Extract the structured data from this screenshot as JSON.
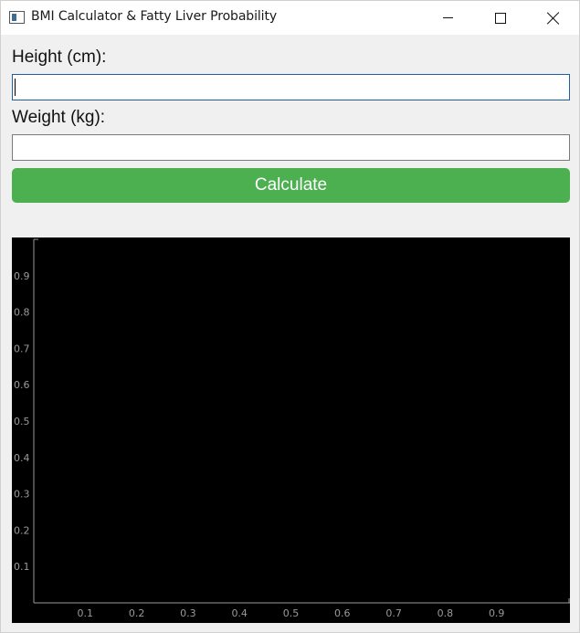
{
  "window": {
    "title": "BMI Calculator & Fatty Liver Probability",
    "icons": {
      "app": "app-window-icon",
      "minimize": "minimize-icon",
      "maximize": "maximize-icon",
      "close": "close-icon"
    }
  },
  "form": {
    "height_label": "Height (cm):",
    "height_value": "",
    "weight_label": "Weight (kg):",
    "weight_value": "",
    "calculate_label": "Calculate",
    "button_color": "#4caf50"
  },
  "chart_data": {
    "type": "scatter",
    "series": [],
    "x_ticks": [
      "0.1",
      "0.2",
      "0.3",
      "0.4",
      "0.5",
      "0.6",
      "0.7",
      "0.8",
      "0.9"
    ],
    "y_ticks": [
      "0.9",
      "0.8",
      "0.7",
      "0.6",
      "0.5",
      "0.4",
      "0.3",
      "0.2",
      "0.1"
    ],
    "xlim": [
      0,
      1
    ],
    "ylim": [
      0,
      1
    ],
    "background": "#000000",
    "axis_color": "#9a9a9a"
  }
}
